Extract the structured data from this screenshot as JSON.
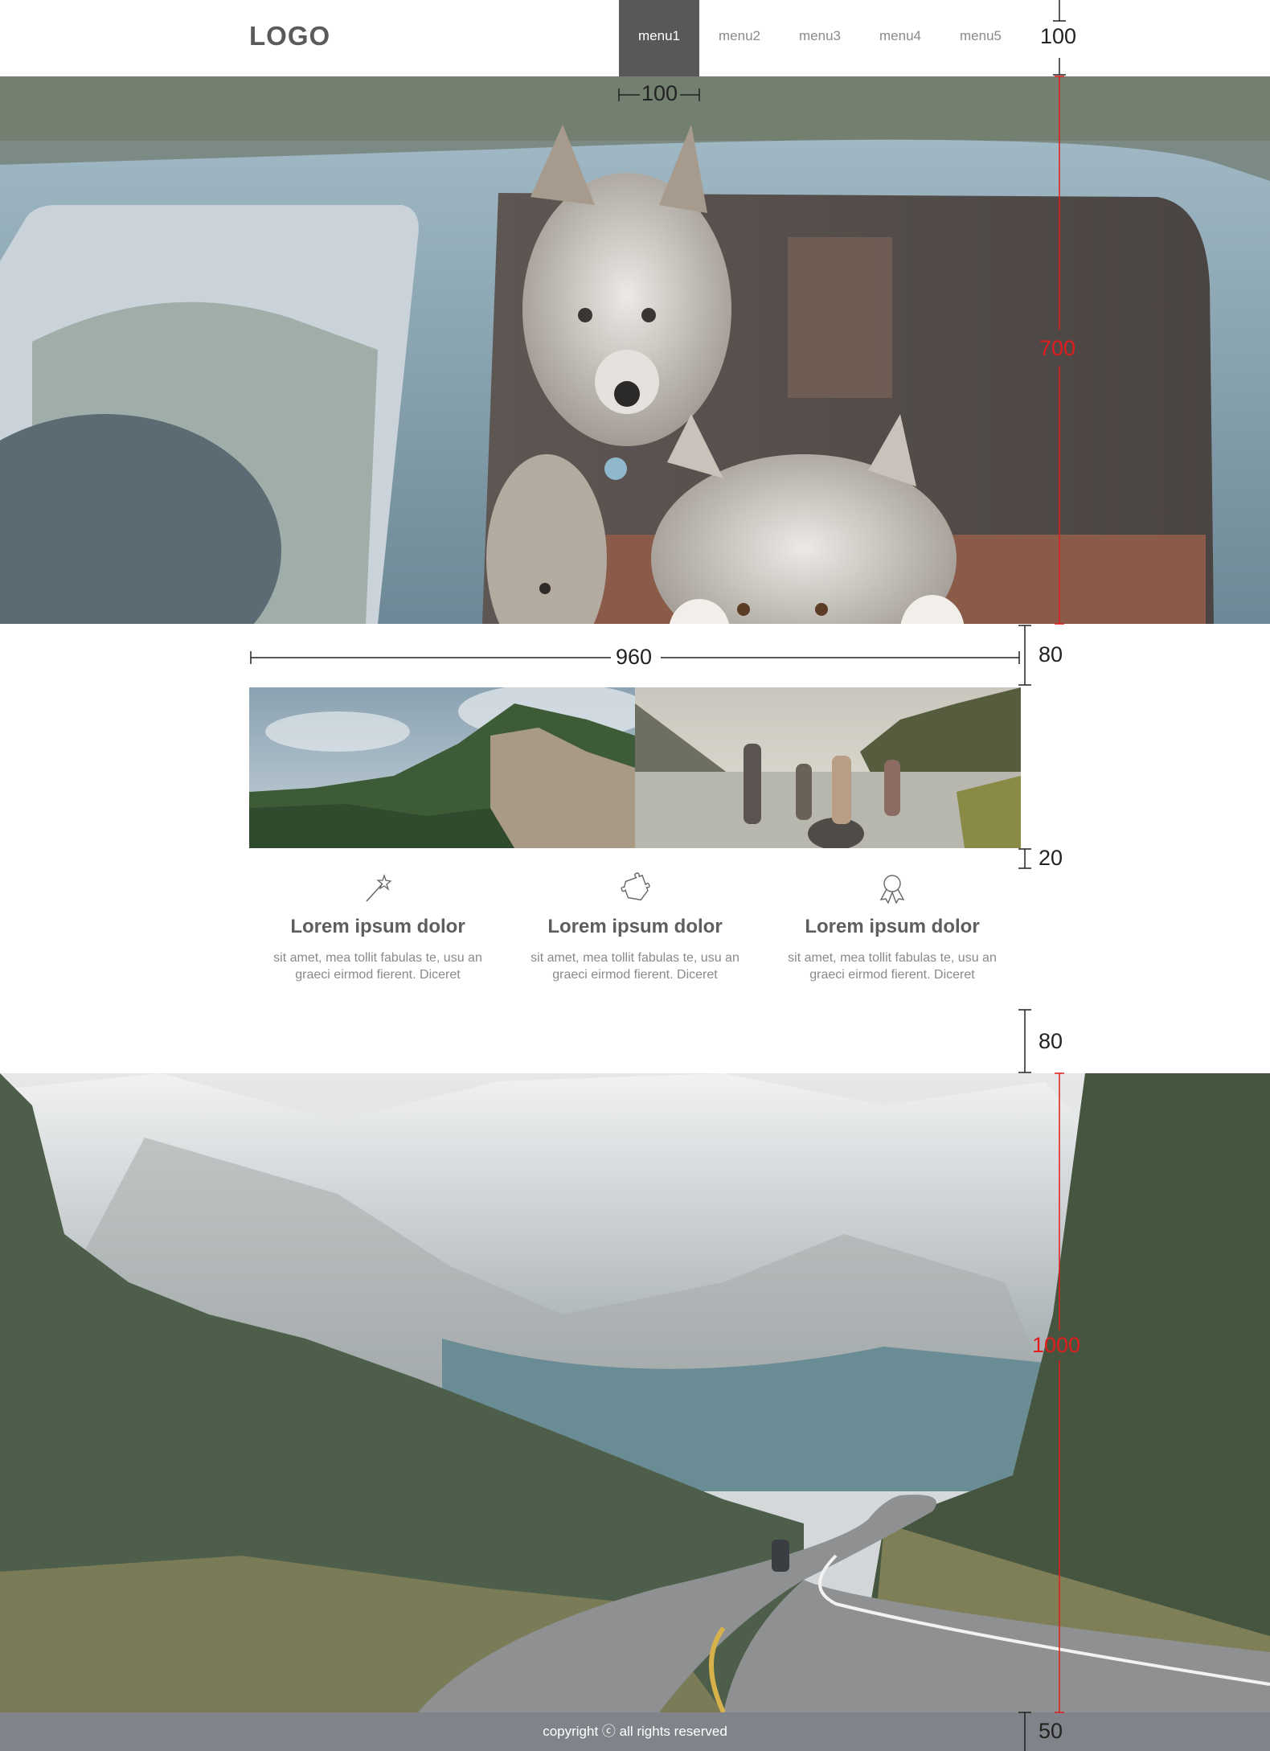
{
  "header": {
    "logo": "LOGO",
    "menu": [
      {
        "label": "menu1",
        "active": true
      },
      {
        "label": "menu2",
        "active": false
      },
      {
        "label": "menu3",
        "active": false
      },
      {
        "label": "menu4",
        "active": false
      },
      {
        "label": "menu5",
        "active": false
      }
    ]
  },
  "features": [
    {
      "icon": "magic-wand-icon",
      "title": "Lorem ipsum dolor",
      "text_line1": "sit amet, mea tollit fabulas te, usu an",
      "text_line2": "graeci eirmod fierent. Diceret"
    },
    {
      "icon": "puzzle-icon",
      "title": "Lorem ipsum dolor",
      "text_line1": "sit amet, mea tollit fabulas te, usu an",
      "text_line2": "graeci eirmod fierent. Diceret"
    },
    {
      "icon": "award-ribbon-icon",
      "title": "Lorem ipsum dolor",
      "text_line1": "sit amet, mea tollit fabulas te, usu an",
      "text_line2": "graeci eirmod fierent. Diceret"
    }
  ],
  "footer": {
    "copyright": "copyright ⓒ all rights reserved"
  },
  "dimensions": {
    "header_height": "100",
    "menu_width": "100",
    "hero_height": "700",
    "content_width": "960",
    "gap_top": "80",
    "gap_mid": "20",
    "gap_bottom": "80",
    "banner_height": "1000",
    "footer_height": "50"
  },
  "colors": {
    "menu_active_bg": "#585858",
    "footer_bg": "#808389",
    "annotation_red": "#e11d1d"
  }
}
